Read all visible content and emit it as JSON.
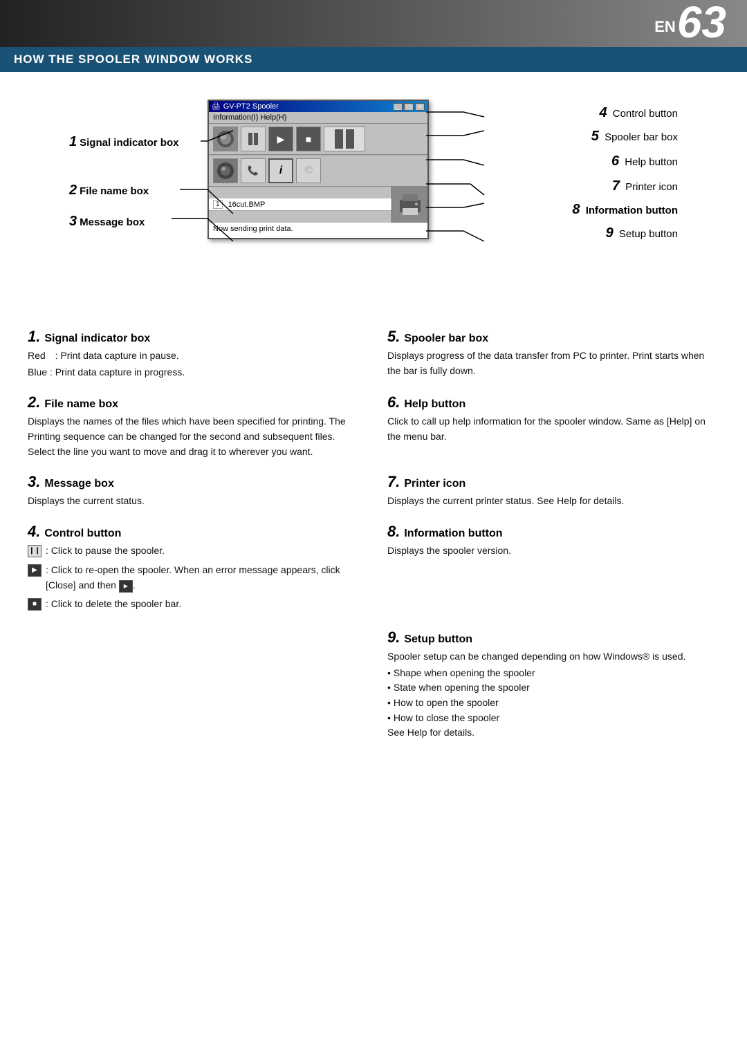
{
  "header": {
    "en_label": "EN",
    "page_number": "63"
  },
  "section_title": "HOW THE SPOOLER WINDOW WORKS",
  "diagram": {
    "window_title": "GV-PT2 Spooler",
    "menu_items": "Information(I)  Help(H)",
    "file_name": "16cut.BMP",
    "message": "Now sending print data.",
    "labels_left": [
      {
        "number": "1",
        "text": "Signal indicator box"
      },
      {
        "number": "2",
        "text": "File name box"
      },
      {
        "number": "3",
        "text": "Message box"
      }
    ],
    "labels_right": [
      {
        "number": "4",
        "text": "Control button"
      },
      {
        "number": "5",
        "text": "Spooler bar box"
      },
      {
        "number": "6",
        "text": "Help button"
      },
      {
        "number": "7",
        "text": "Printer icon"
      },
      {
        "number": "8",
        "text": "Information button"
      },
      {
        "number": "9",
        "text": "Setup button"
      }
    ]
  },
  "items": [
    {
      "number": "1",
      "title": "Signal indicator box",
      "body": [
        "Red　: Print data capture in pause.",
        "Blue : Print data capture in progress."
      ]
    },
    {
      "number": "2",
      "title": "File name box",
      "body": [
        "Displays the names of the files which have been specified for printing. The Printing sequence can be changed for the second and subsequent files.  Select the line you want to move and drag it to wherever you want."
      ]
    },
    {
      "number": "3",
      "title": "Message box",
      "body": [
        "Displays the current status."
      ]
    },
    {
      "number": "4",
      "title": "Control button",
      "body": [],
      "subitems": [
        {
          "icon": "❙❙",
          "dark": false,
          "text": ": Click to pause the spooler."
        },
        {
          "icon": "▶",
          "dark": true,
          "text": ": Click to re-open the spooler. When an error message appears, click [Close] and then ▶."
        },
        {
          "icon": "■",
          "dark": true,
          "text": ": Click to delete the spooler bar."
        }
      ]
    },
    {
      "number": "5",
      "title": "Spooler bar box",
      "body": [
        "Displays progress of the data transfer from PC to printer. Print starts when the bar is fully down."
      ]
    },
    {
      "number": "6",
      "title": "Help button",
      "body": [
        "Click to call up help information for the spooler window. Same as [Help] on the menu bar."
      ]
    },
    {
      "number": "7",
      "title": "Printer icon",
      "body": [
        "Displays the current printer status.  See Help for details."
      ]
    },
    {
      "number": "8",
      "title": "Information button",
      "body": [
        "Displays the spooler version."
      ]
    },
    {
      "number": "9",
      "title": "Setup button",
      "body": [
        "Spooler setup can be changed depending on how Windows® is used."
      ],
      "bullets": [
        "Shape when opening the spooler",
        "State when opening the spooler",
        "How to open the spooler",
        "How to close the spooler",
        "See Help for details."
      ]
    }
  ]
}
